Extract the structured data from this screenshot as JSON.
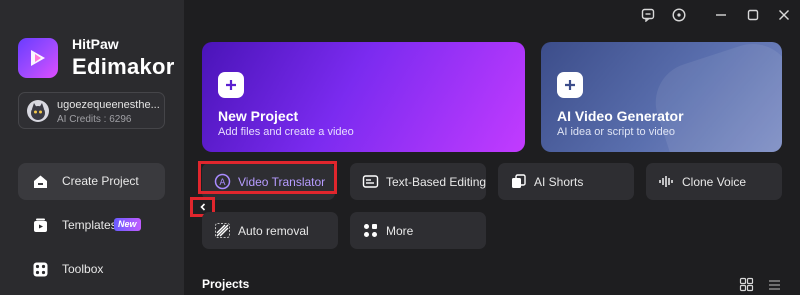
{
  "brand": {
    "line1": "HitPaw",
    "line2": "Edimakor"
  },
  "user": {
    "name": "ugoezequeenesthe...",
    "credits": "AI Credits : 6296"
  },
  "sidebar": {
    "items": [
      {
        "label": "Create Project",
        "icon": "home-icon",
        "active": true
      },
      {
        "label": "Templates",
        "icon": "templates-icon",
        "badge": "New"
      },
      {
        "label": "Toolbox",
        "icon": "toolbox-icon"
      }
    ]
  },
  "window_controls": [
    "feedback-icon",
    "info-icon",
    "minimize-icon",
    "maximize-icon",
    "close-icon"
  ],
  "hero": {
    "new_project": {
      "title": "New Project",
      "subtitle": "Add files and create a video"
    },
    "ai_video": {
      "title": "AI Video Generator",
      "subtitle": "AI idea or script to video"
    }
  },
  "tools": [
    {
      "label": "Video Translator",
      "icon": "translate-icon",
      "highlighted": true
    },
    {
      "label": "Text-Based Editing",
      "icon": "text-edit-icon"
    },
    {
      "label": "AI Shorts",
      "icon": "shorts-icon"
    },
    {
      "label": "Clone Voice",
      "icon": "waveform-icon"
    },
    {
      "label": "Auto removal",
      "icon": "removal-icon"
    },
    {
      "label": "More",
      "icon": "more-grid-icon"
    }
  ],
  "projects": {
    "title": "Projects"
  },
  "colors": {
    "accent": "#7b2bf0",
    "highlight_border": "#e0262d",
    "background": "#1e1e20",
    "sidebar": "#2b2b2e"
  }
}
